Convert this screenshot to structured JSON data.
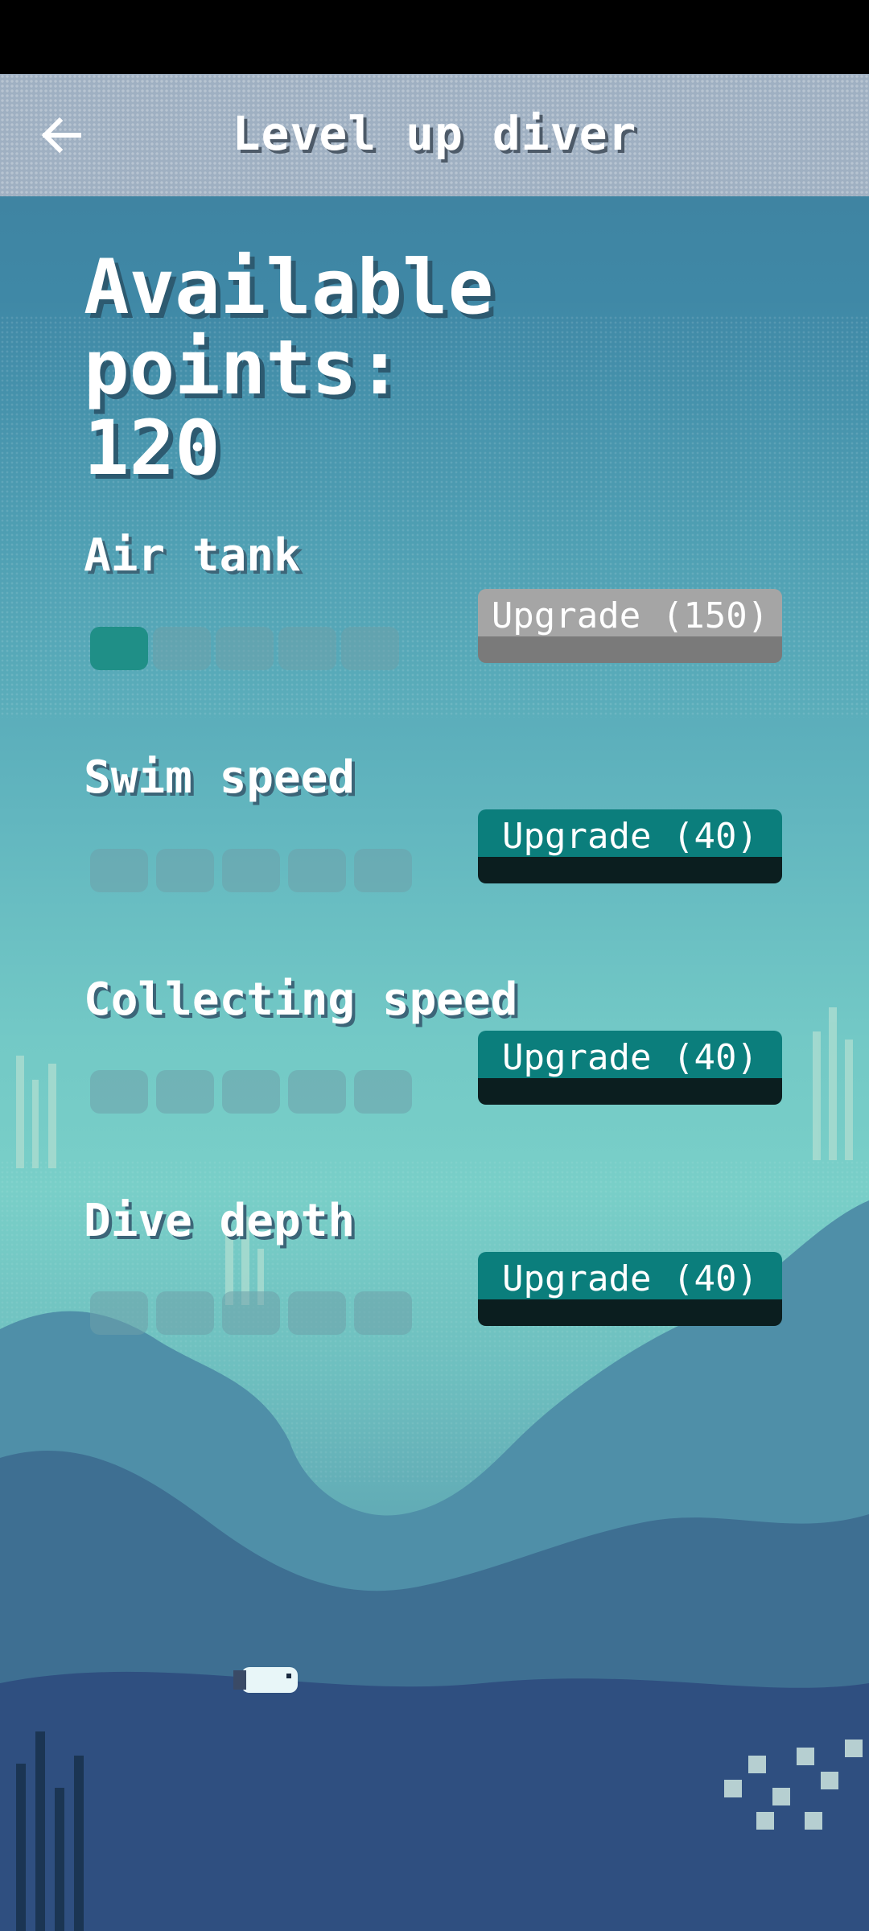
{
  "header": {
    "title": "Level up diver",
    "back_icon": "arrow-left-icon"
  },
  "points": {
    "label": "Available points:",
    "value": "120"
  },
  "skills": [
    {
      "name": "Air tank",
      "level": 1,
      "max_level": 5,
      "button": "Upgrade (150)",
      "enabled": false
    },
    {
      "name": "Swim speed",
      "level": 0,
      "max_level": 5,
      "button": "Upgrade (40)",
      "enabled": true
    },
    {
      "name": "Collecting speed",
      "level": 0,
      "max_level": 5,
      "button": "Upgrade (40)",
      "enabled": true
    },
    {
      "name": "Dive depth",
      "level": 0,
      "max_level": 5,
      "button": "Upgrade (40)",
      "enabled": true
    }
  ],
  "colors": {
    "button_active": "#0b7e7c",
    "button_disabled": "#a5a5a5",
    "pip_filled": "#1f8f87"
  }
}
